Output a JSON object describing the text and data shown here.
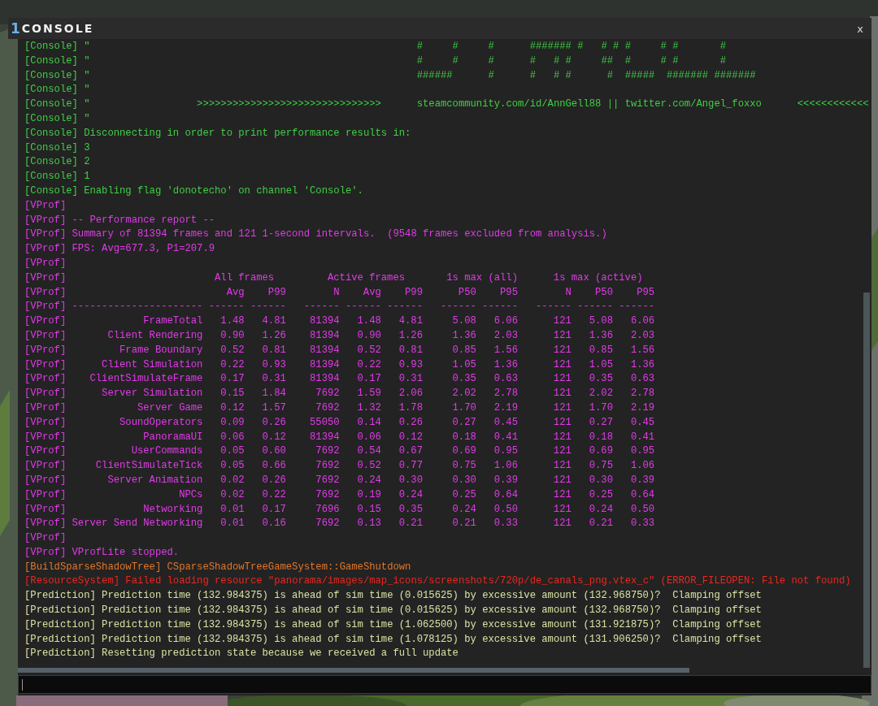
{
  "window": {
    "badge": "1",
    "title": "CONSOLE",
    "close": "x"
  },
  "console": {
    "lines": [
      {
        "kind": "text",
        "color": "#3fcf45",
        "tag": "[Console]",
        "text": "\"                                                       #     #     #      ####### #   # # #     # #       #"
      },
      {
        "kind": "text",
        "color": "#3fcf45",
        "tag": "[Console]",
        "text": "\"                                                       #     #     #      #   # #     ##  #     # #       #"
      },
      {
        "kind": "text",
        "color": "#3fcf45",
        "tag": "[Console]",
        "text": "\"                                                       ######      #      #   # #      #  #####  ####### #######"
      },
      {
        "kind": "text",
        "color": "#3fcf45",
        "tag": "[Console]",
        "text": "\""
      },
      {
        "kind": "text",
        "color": "#3fcf45",
        "tag": "[Console]",
        "text": "\"                  >>>>>>>>>>>>>>>>>>>>>>>>>>>>>>>      steamcommunity.com/id/AnnGell88 || twitter.com/Angel_foxxo      <<<<<<<<<<<<"
      },
      {
        "kind": "text",
        "color": "#3fcf45",
        "tag": "[Console]",
        "text": "\""
      },
      {
        "kind": "text",
        "color": "#3fcf45",
        "tag": "[Console]",
        "text": "Disconnecting in order to print performance results in:"
      },
      {
        "kind": "text",
        "color": "#3fcf45",
        "tag": "[Console]",
        "text": "3"
      },
      {
        "kind": "text",
        "color": "#3fcf45",
        "tag": "[Console]",
        "text": "2"
      },
      {
        "kind": "text",
        "color": "#3fcf45",
        "tag": "[Console]",
        "text": "1"
      },
      {
        "kind": "text",
        "color": "#3fcf45",
        "tag": "[Console]",
        "text": "Enabling flag 'donotecho' on channel 'Console'."
      },
      {
        "kind": "text",
        "color": "#e03be8",
        "tag": "[VProf]"
      },
      {
        "kind": "text",
        "color": "#e03be8",
        "tag": "[VProf]",
        "text": "-- Performance report --"
      },
      {
        "kind": "text",
        "color": "#e03be8",
        "tag": "[VProf]",
        "text": "Summary of 81394 frames and 121 1-second intervals.  (9548 frames excluded from analysis.)"
      },
      {
        "kind": "text",
        "color": "#e03be8",
        "tag": "[VProf]",
        "text": "FPS: Avg=677.3, P1=207.9"
      },
      {
        "kind": "text",
        "color": "#e03be8",
        "tag": "[VProf]"
      },
      {
        "kind": "groups",
        "color": "#e03be8",
        "tag": "[VProf]",
        "cells": [
          "All frames",
          "Active frames",
          "1s max (all)",
          "1s max (active)"
        ]
      },
      {
        "kind": "columns",
        "color": "#e03be8",
        "tag": "[VProf]",
        "cells": [
          "Avg",
          "P99",
          "N",
          "Avg",
          "P99",
          "P50",
          "P95",
          "N",
          "P50",
          "P95"
        ]
      },
      {
        "kind": "rule",
        "color": "#e03be8",
        "tag": "[VProf]",
        "name": "----------------------",
        "cells": [
          "------",
          "------",
          "------",
          "------",
          "------",
          "------",
          "------",
          "------",
          "------",
          "------"
        ]
      },
      {
        "kind": "row",
        "color": "#e03be8",
        "tag": "[VProf]",
        "name": "FrameTotal",
        "cells": [
          "1.48",
          "4.81",
          "81394",
          "1.48",
          "4.81",
          "5.08",
          "6.06",
          "121",
          "5.08",
          "6.06"
        ]
      },
      {
        "kind": "row",
        "color": "#e03be8",
        "tag": "[VProf]",
        "name": "Client Rendering",
        "cells": [
          "0.90",
          "1.26",
          "81394",
          "0.90",
          "1.26",
          "1.36",
          "2.03",
          "121",
          "1.36",
          "2.03"
        ]
      },
      {
        "kind": "row",
        "color": "#e03be8",
        "tag": "[VProf]",
        "name": "Frame Boundary",
        "cells": [
          "0.52",
          "0.81",
          "81394",
          "0.52",
          "0.81",
          "0.85",
          "1.56",
          "121",
          "0.85",
          "1.56"
        ]
      },
      {
        "kind": "row",
        "color": "#e03be8",
        "tag": "[VProf]",
        "name": "Client Simulation",
        "cells": [
          "0.22",
          "0.93",
          "81394",
          "0.22",
          "0.93",
          "1.05",
          "1.36",
          "121",
          "1.05",
          "1.36"
        ]
      },
      {
        "kind": "row",
        "color": "#e03be8",
        "tag": "[VProf]",
        "name": "ClientSimulateFrame",
        "cells": [
          "0.17",
          "0.31",
          "81394",
          "0.17",
          "0.31",
          "0.35",
          "0.63",
          "121",
          "0.35",
          "0.63"
        ]
      },
      {
        "kind": "row",
        "color": "#e03be8",
        "tag": "[VProf]",
        "name": "Server Simulation",
        "cells": [
          "0.15",
          "1.84",
          "7692",
          "1.59",
          "2.06",
          "2.02",
          "2.78",
          "121",
          "2.02",
          "2.78"
        ]
      },
      {
        "kind": "row",
        "color": "#e03be8",
        "tag": "[VProf]",
        "name": "Server Game",
        "cells": [
          "0.12",
          "1.57",
          "7692",
          "1.32",
          "1.78",
          "1.70",
          "2.19",
          "121",
          "1.70",
          "2.19"
        ]
      },
      {
        "kind": "row",
        "color": "#e03be8",
        "tag": "[VProf]",
        "name": "SoundOperators",
        "cells": [
          "0.09",
          "0.26",
          "55050",
          "0.14",
          "0.26",
          "0.27",
          "0.45",
          "121",
          "0.27",
          "0.45"
        ]
      },
      {
        "kind": "row",
        "color": "#e03be8",
        "tag": "[VProf]",
        "name": "PanoramaUI",
        "cells": [
          "0.06",
          "0.12",
          "81394",
          "0.06",
          "0.12",
          "0.18",
          "0.41",
          "121",
          "0.18",
          "0.41"
        ]
      },
      {
        "kind": "row",
        "color": "#e03be8",
        "tag": "[VProf]",
        "name": "UserCommands",
        "cells": [
          "0.05",
          "0.60",
          "7692",
          "0.54",
          "0.67",
          "0.69",
          "0.95",
          "121",
          "0.69",
          "0.95"
        ]
      },
      {
        "kind": "row",
        "color": "#e03be8",
        "tag": "[VProf]",
        "name": "ClientSimulateTick",
        "cells": [
          "0.05",
          "0.66",
          "7692",
          "0.52",
          "0.77",
          "0.75",
          "1.06",
          "121",
          "0.75",
          "1.06"
        ]
      },
      {
        "kind": "row",
        "color": "#e03be8",
        "tag": "[VProf]",
        "name": "Server Animation",
        "cells": [
          "0.02",
          "0.26",
          "7692",
          "0.24",
          "0.30",
          "0.30",
          "0.39",
          "121",
          "0.30",
          "0.39"
        ]
      },
      {
        "kind": "row",
        "color": "#e03be8",
        "tag": "[VProf]",
        "name": "NPCs",
        "cells": [
          "0.02",
          "0.22",
          "7692",
          "0.19",
          "0.24",
          "0.25",
          "0.64",
          "121",
          "0.25",
          "0.64"
        ]
      },
      {
        "kind": "row",
        "color": "#e03be8",
        "tag": "[VProf]",
        "name": "Networking",
        "cells": [
          "0.01",
          "0.17",
          "7696",
          "0.15",
          "0.35",
          "0.24",
          "0.50",
          "121",
          "0.24",
          "0.50"
        ]
      },
      {
        "kind": "row",
        "color": "#e03be8",
        "tag": "[VProf]",
        "name": "Server Send Networking",
        "cells": [
          "0.01",
          "0.16",
          "7692",
          "0.13",
          "0.21",
          "0.21",
          "0.33",
          "121",
          "0.21",
          "0.33"
        ]
      },
      {
        "kind": "text",
        "color": "#e03be8",
        "tag": "[VProf]"
      },
      {
        "kind": "text",
        "color": "#e03be8",
        "tag": "[VProf]",
        "text": "VProfLite stopped."
      },
      {
        "kind": "text",
        "color": "#e2772a",
        "tag": "[BuildSparseShadowTree]",
        "text": "CSparseShadowTreeGameSystem::GameShutdown"
      },
      {
        "kind": "text",
        "color": "#e8281f",
        "tag": "[ResourceSystem]",
        "text": "Failed loading resource \"panorama/images/map_icons/screenshots/720p/de_canals_png.vtex_c\" (ERROR_FILEOPEN: File not found)"
      },
      {
        "kind": "text",
        "color": "#dce2a2",
        "tag": "[Prediction]",
        "text": "Prediction time (132.984375) is ahead of sim time (0.015625) by excessive amount (132.968750)?  Clamping offset"
      },
      {
        "kind": "text",
        "color": "#dce2a2",
        "tag": "[Prediction]",
        "text": "Prediction time (132.984375) is ahead of sim time (0.015625) by excessive amount (132.968750)?  Clamping offset"
      },
      {
        "kind": "text",
        "color": "#dce2a2",
        "tag": "[Prediction]",
        "text": "Prediction time (132.984375) is ahead of sim time (1.062500) by excessive amount (131.921875)?  Clamping offset"
      },
      {
        "kind": "text",
        "color": "#dce2a2",
        "tag": "[Prediction]",
        "text": "Prediction time (132.984375) is ahead of sim time (1.078125) by excessive amount (131.906250)?  Clamping offset"
      },
      {
        "kind": "text",
        "color": "#dce2a2",
        "tag": "[Prediction]",
        "text": "Resetting prediction state because we received a full update"
      }
    ]
  }
}
